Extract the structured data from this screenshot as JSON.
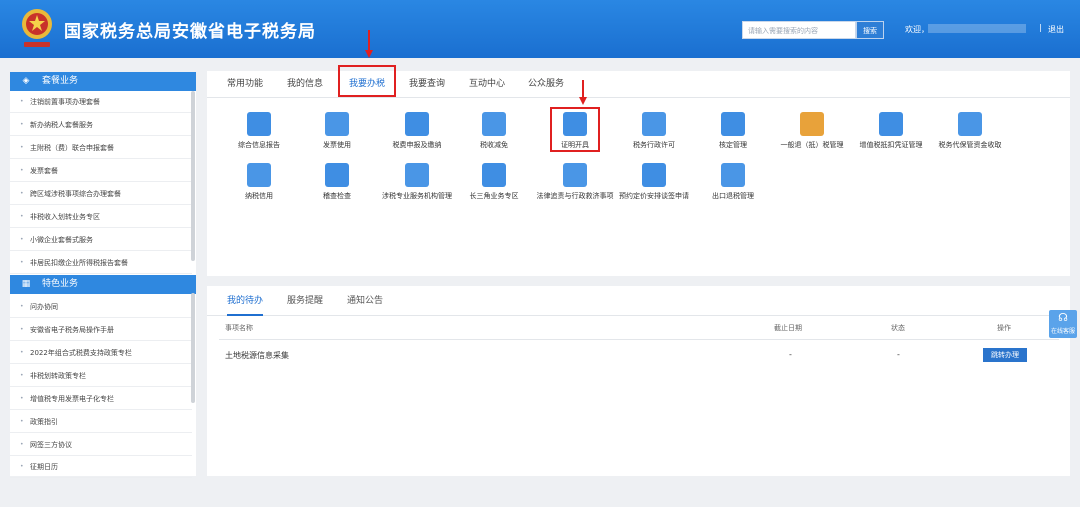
{
  "header": {
    "title": "国家税务总局安徽省电子税务局",
    "search_placeholder": "请输入需要搜索的内容",
    "search_button": "搜索",
    "welcome": "欢迎，",
    "separator": "|",
    "logout": "退出"
  },
  "sidebar": {
    "section1": {
      "title": "套餐业务",
      "items": [
        "注销前置事项办理套餐",
        "新办纳税人套餐服务",
        "主附税（费）联合申报套餐",
        "发票套餐",
        "跨区域涉税事项综合办理套餐",
        "非税收入划转业务专区",
        "小微企业套餐式服务",
        "非居民扣缴企业所得税报告套餐"
      ]
    },
    "section2": {
      "title": "特色业务",
      "items": [
        "问办协同",
        "安徽省电子税务局操作手册",
        "2022年组合式税费支持政策专栏",
        "非税划转政策专栏",
        "增值税专用发票电子化专栏",
        "政策指引",
        "网签三方协议",
        "征期日历"
      ]
    }
  },
  "main": {
    "tabs": [
      "常用功能",
      "我的信息",
      "我要办税",
      "我要查询",
      "互动中心",
      "公众服务"
    ],
    "tiles": [
      "综合信息报告",
      "发票使用",
      "税费申报及缴纳",
      "税收减免",
      "证明开具",
      "税务行政许可",
      "核定管理",
      "一般退（抵）税管理",
      "增值税抵扣凭证管理",
      "税务代保管资金收取",
      "纳税信用",
      "稽查检查",
      "涉税专业服务机构管理",
      "长三角业务专区",
      "法律追责与行政救济事项",
      "预约定价安排谈签申请",
      "出口退税管理"
    ]
  },
  "bottom": {
    "tabs": [
      "我的待办",
      "服务提醒",
      "通知公告"
    ],
    "columns": [
      "事项名称",
      "截止日期",
      "状态",
      "操作"
    ],
    "rows": [
      {
        "name": "土地税源信息采集",
        "deadline": "-",
        "status": "-",
        "action": "跳转办理"
      }
    ]
  },
  "float": {
    "label": "在线客服"
  },
  "colors": {
    "header": "#1f78d8",
    "accent": "#2f88e0",
    "highlight": "#e02020"
  }
}
